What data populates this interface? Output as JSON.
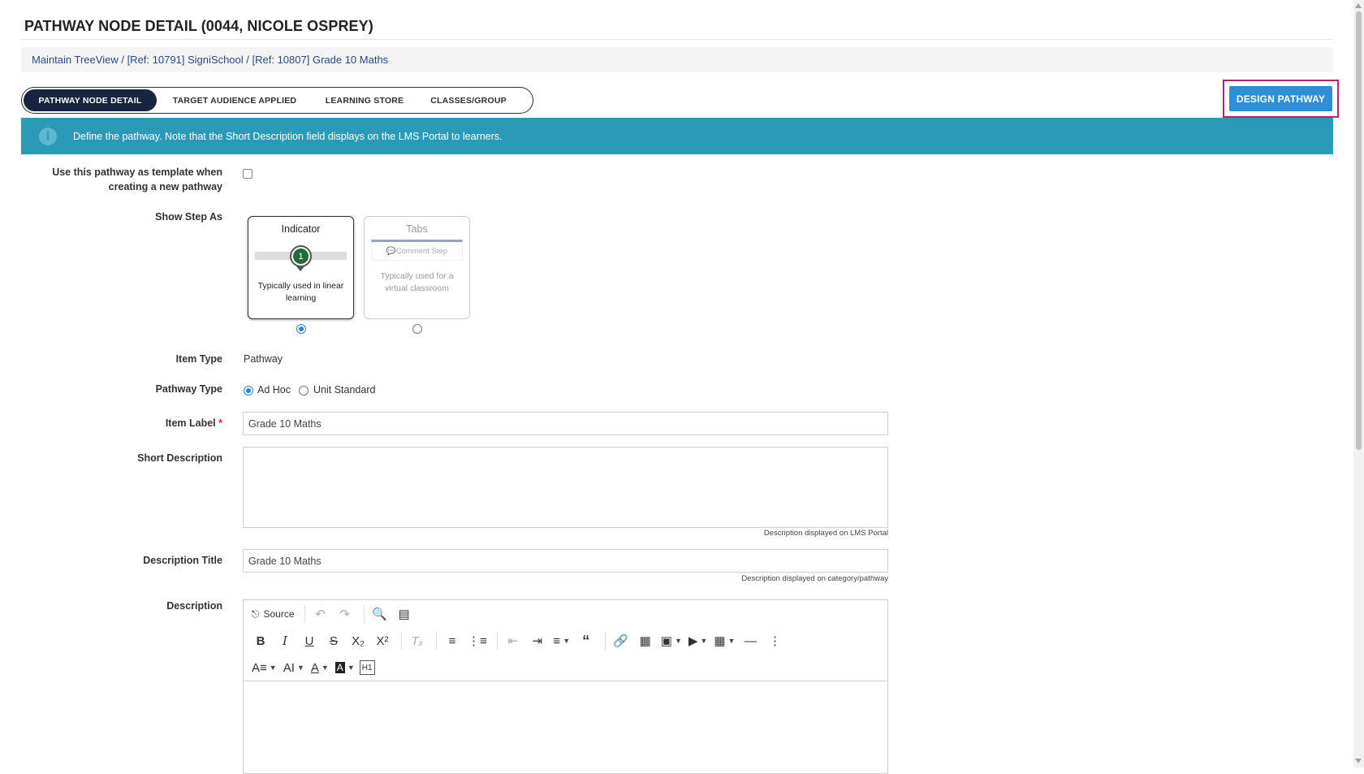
{
  "page": {
    "title": "PATHWAY NODE DETAIL (0044, NICOLE OSPREY)",
    "breadcrumb": {
      "items": [
        "Maintain TreeView",
        "[Ref: 10791] SigniSchool",
        "[Ref: 10807] Grade 10 Maths"
      ],
      "separator": " / "
    }
  },
  "tabs": [
    {
      "label": "PATHWAY NODE DETAIL",
      "active": true
    },
    {
      "label": "TARGET AUDIENCE APPLIED",
      "active": false
    },
    {
      "label": "LEARNING STORE",
      "active": false
    },
    {
      "label": "CLASSES/GROUP",
      "active": false
    }
  ],
  "design_button": "DESIGN PATHWAY",
  "info_text": "Define the pathway. Note that the Short Description field displays on the LMS Portal to learners.",
  "form": {
    "template_label": "Use this pathway as template when creating a new pathway",
    "template_checked": false,
    "show_step_label": "Show Step As",
    "step_options": [
      {
        "title": "Indicator",
        "badge": "1",
        "desc": "Typically used in linear learning",
        "selected": true
      },
      {
        "title": "Tabs",
        "tab_text": "Comment Step",
        "desc": "Typically used for a virtual classroom",
        "selected": false
      }
    ],
    "item_type_label": "Item Type",
    "item_type_value": "Pathway",
    "pathway_type_label": "Pathway Type",
    "pathway_type_options": [
      {
        "label": "Ad Hoc",
        "selected": true
      },
      {
        "label": "Unit Standard",
        "selected": false
      }
    ],
    "item_label_label": "Item Label",
    "required_mark": "*",
    "item_label_value": "Grade 10 Maths",
    "short_desc_label": "Short Description",
    "short_desc_value": "",
    "short_desc_hint": "Description displayed on LMS Portal",
    "desc_title_label": "Description Title",
    "desc_title_value": "Grade 10 Maths",
    "desc_title_hint": "Description displayed on category/pathway",
    "description_label": "Description",
    "editor_source_label": "Source"
  },
  "colors": {
    "accent": "#2a9ab8",
    "tab_active": "#16243f",
    "button": "#2f8fd6",
    "highlight_border": "#b3266b",
    "indicator_badge": "#1f6b3a"
  }
}
